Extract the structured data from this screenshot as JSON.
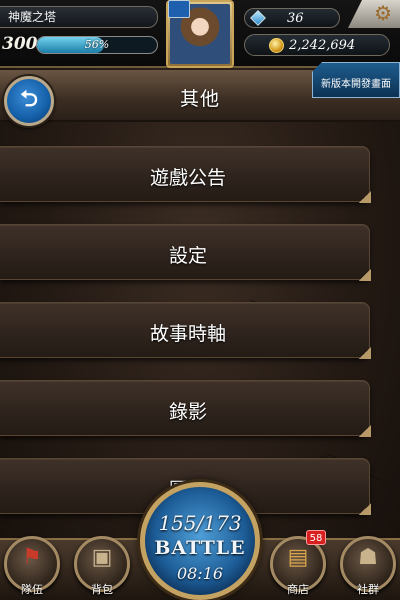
{
  "hud": {
    "game_title": "神魔之塔",
    "level": "300",
    "exp_percent": "56%",
    "exp_fraction": 0.56,
    "gems": "36",
    "gold": "2,242,694"
  },
  "header": {
    "title": "其他",
    "new_version_label": "新版本開發畫面"
  },
  "menu": {
    "items": [
      {
        "label": "遊戲公告"
      },
      {
        "label": "設定"
      },
      {
        "label": "故事時軸"
      },
      {
        "label": "錄影"
      },
      {
        "label": "圖鑑"
      }
    ]
  },
  "bottom_nav": {
    "team_label": "隊伍",
    "bag_label": "背包",
    "shop_label": "商店",
    "shop_badge": "58",
    "social_label": "社群"
  },
  "battle": {
    "stamina": "155/173",
    "label": "BATTLE",
    "timer": "08:16"
  },
  "colors": {
    "accent_blue": "#1d5d97",
    "gold_trim": "#c4a261",
    "badge_red": "#d71f1f"
  },
  "icons": {
    "back": "back-arrow-icon",
    "settings": "gear-icon",
    "gem": "diamond-icon",
    "gold": "coin-icon",
    "team": "flag-icon",
    "bag": "backpack-icon",
    "shop": "chest-icon",
    "social": "people-icon"
  }
}
